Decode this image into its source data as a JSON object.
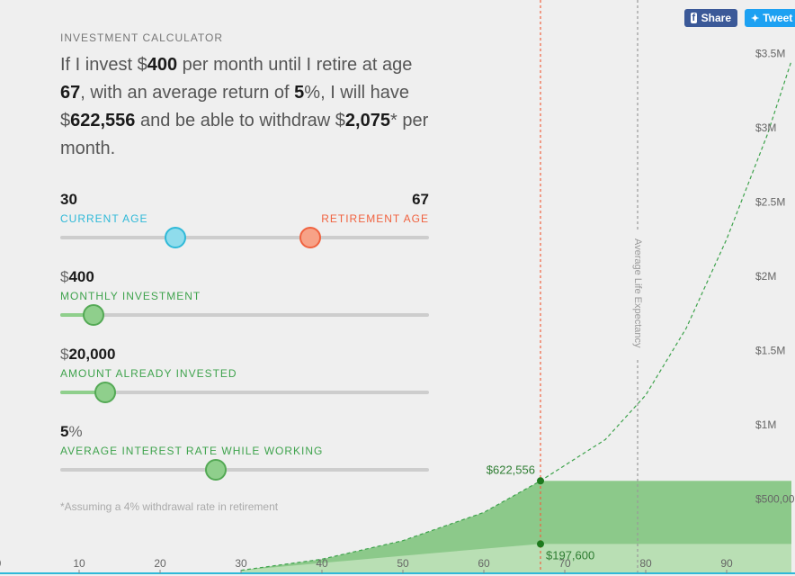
{
  "header": {
    "eyebrow": "INVESTMENT CALCULATOR"
  },
  "summary": {
    "t1": "If I invest $",
    "monthly": "400",
    "t2": " per month until I retire at age ",
    "retire_age": "67",
    "t3": ", with an average return of ",
    "rate": "5",
    "t4": "%, I will have $",
    "total": "622,556",
    "t5": " and be able to withdraw $",
    "withdraw": "2,075",
    "t6": "* per month."
  },
  "controls": {
    "current_age": {
      "value": "30",
      "label": "CURRENT AGE"
    },
    "retirement_age": {
      "value": "67",
      "label": "RETIREMENT AGE"
    },
    "monthly": {
      "prefix": "$",
      "value": "400",
      "label": "MONTHLY INVESTMENT"
    },
    "invested": {
      "prefix": "$",
      "value": "20,000",
      "label": "AMOUNT ALREADY INVESTED"
    },
    "rate": {
      "value": "5",
      "suffix": "%",
      "label": "AVERAGE INTEREST RATE WHILE WORKING"
    }
  },
  "sliders": {
    "age_current_fraction": 0.31,
    "age_retire_fraction": 0.675,
    "monthly_fraction": 0.088,
    "invested_fraction": 0.12,
    "rate_fraction": 0.42
  },
  "footnote": "*Assuming a 4% withdrawal rate in retirement",
  "share": {
    "facebook": "Share",
    "twitter": "Tweet"
  },
  "colors": {
    "green": "#3fa34d",
    "cyan": "#2fb9d8",
    "orange": "#f0623f",
    "area_dark": "#8cc98a",
    "area_light": "#b9dfb4"
  },
  "chart_data": {
    "type": "area",
    "xlabel": "",
    "ylabel": "",
    "x_ticks": [
      "0",
      "10",
      "20",
      "30",
      "40",
      "50",
      "60",
      "70",
      "80",
      "90"
    ],
    "y_ticks": [
      "$500,00",
      "$1M",
      "$1.5M",
      "$2M",
      "$2.5M",
      "$3M",
      "$3.5M"
    ],
    "xlim": [
      0,
      98
    ],
    "ylim": [
      0,
      3600000
    ],
    "retirement_age": 67,
    "life_expectancy_age": 79,
    "life_expectancy_label": "Average Life Expectancy",
    "marker_total": {
      "age": 67,
      "value": 622556,
      "label": "$622,556"
    },
    "marker_contributed": {
      "age": 67,
      "value": 197600,
      "label": "$197,600"
    },
    "growth_curve": [
      {
        "x": 30,
        "y": 20000
      },
      {
        "x": 40,
        "y": 95000
      },
      {
        "x": 50,
        "y": 220000
      },
      {
        "x": 60,
        "y": 410000
      },
      {
        "x": 67,
        "y": 622556
      },
      {
        "x": 75,
        "y": 900000
      },
      {
        "x": 80,
        "y": 1200000
      },
      {
        "x": 85,
        "y": 1650000
      },
      {
        "x": 90,
        "y": 2250000
      },
      {
        "x": 95,
        "y": 2950000
      },
      {
        "x": 98,
        "y": 3450000
      }
    ],
    "contributed": [
      {
        "x": 30,
        "y": 20000
      },
      {
        "x": 67,
        "y": 197600
      }
    ],
    "post_retirement_total": 622556,
    "post_retirement_contributed": 197600
  }
}
